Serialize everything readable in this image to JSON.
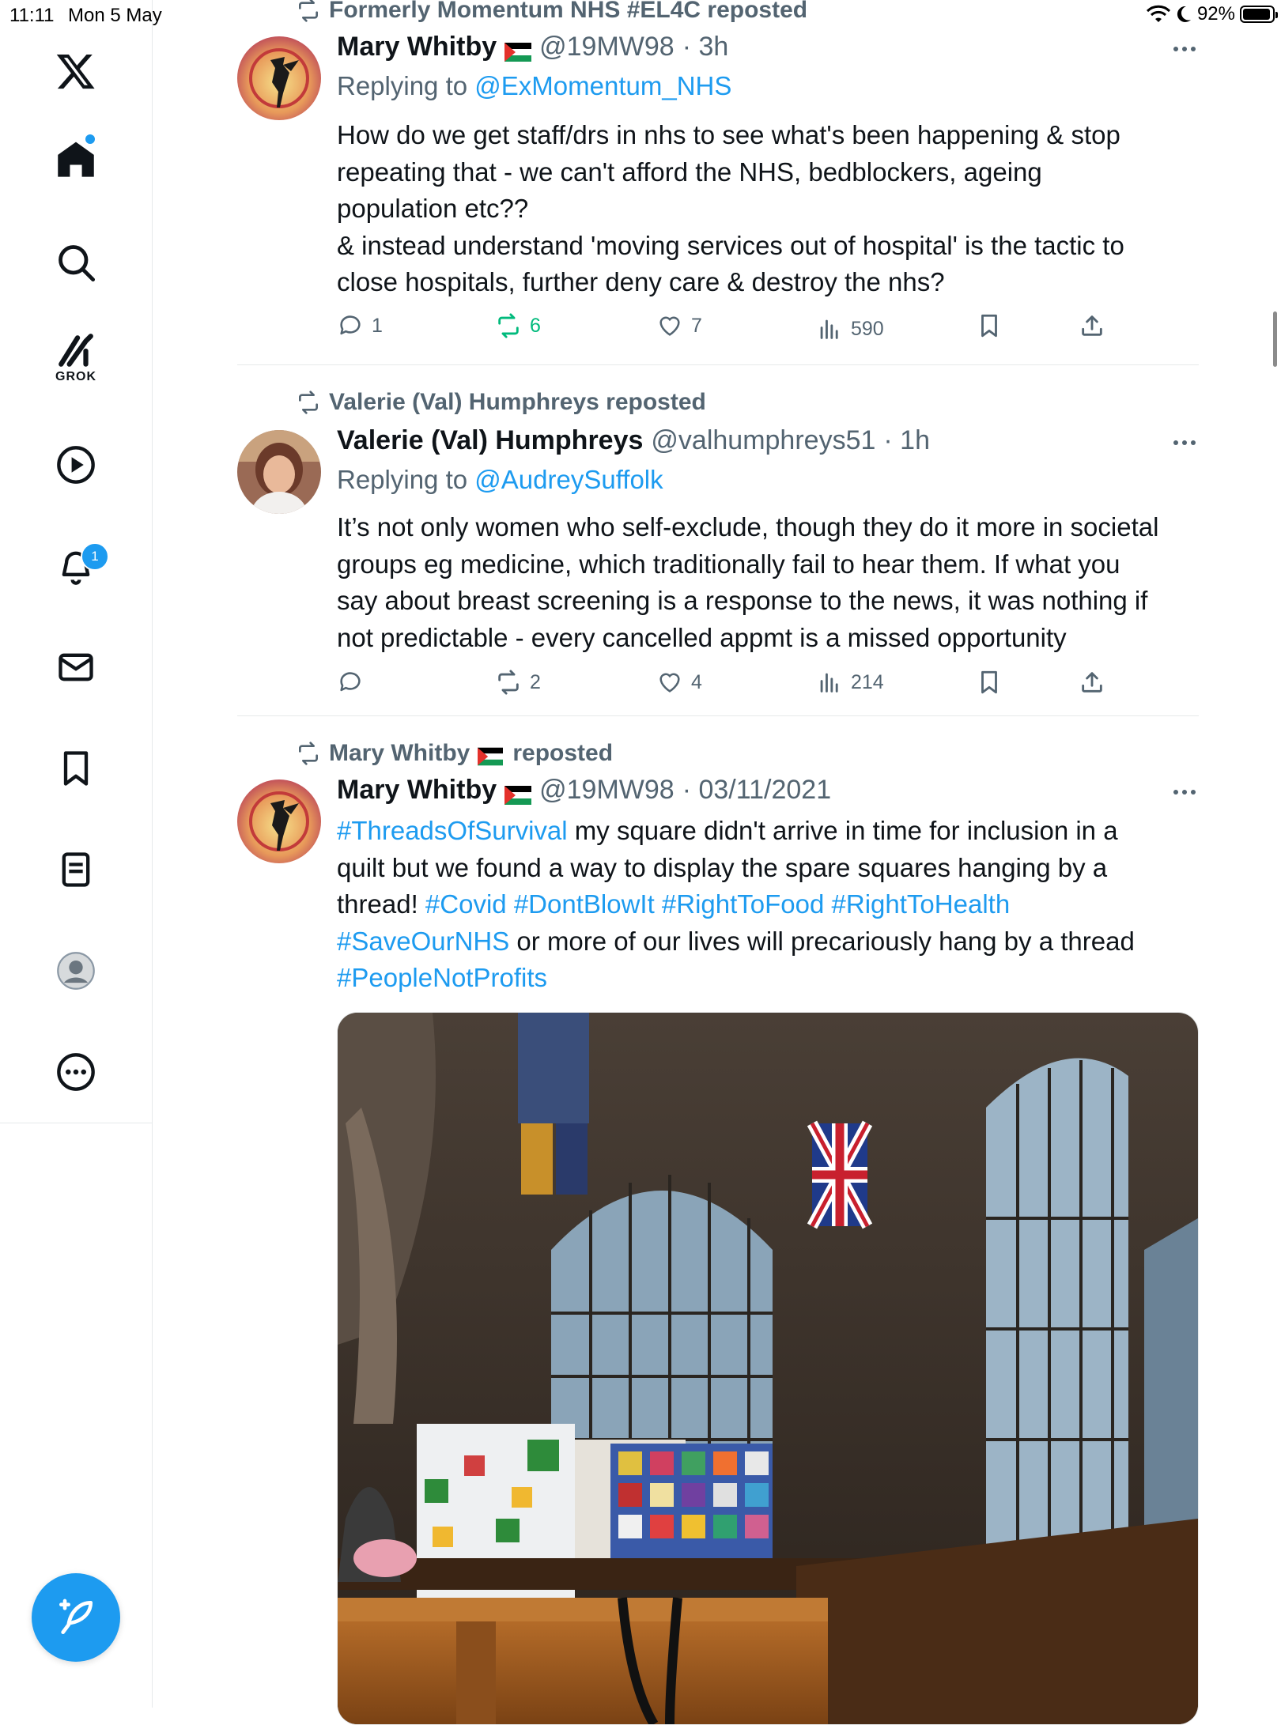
{
  "status_bar": {
    "time": "11:11",
    "date": "Mon 5 May",
    "battery": "92%"
  },
  "sidebar": {
    "grok_label": "GROK",
    "notifications_badge": "1",
    "items": [
      "x-logo",
      "home",
      "search",
      "grok",
      "videos",
      "notifications",
      "messages",
      "bookmarks",
      "lists",
      "profile",
      "more"
    ]
  },
  "tweets": [
    {
      "repost_by": "Formerly Momentum NHS #EL4C reposted",
      "name": "Mary Whitby",
      "handle": "@19MW98",
      "time": "· 3h",
      "replying_prefix": "Replying to",
      "replying_to": "@ExMomentum_NHS",
      "text_lines": [
        "How do we get staff/drs in nhs to see what's been happening & stop",
        "repeating that - we can't afford the NHS, bedblockers, ageing",
        "population etc??",
        "& instead understand 'moving services out of hospital' is the tactic to",
        "close hospitals, further deny care & destroy the nhs?"
      ],
      "replies": "1",
      "reposts": "6",
      "likes": "7",
      "views": "590"
    },
    {
      "repost_by": "Valerie (Val) Humphreys reposted",
      "name": "Valerie (Val) Humphreys",
      "handle": "@valhumphreys51",
      "time": "· 1h",
      "replying_prefix": "Replying to",
      "replying_to": "@AudreySuffolk",
      "text_lines": [
        "It’s not only women who self-exclude, though they do it more in societal",
        "groups eg medicine, which traditionally fail to hear them. If what you",
        "say about breast screening is a response to the news, it was nothing if",
        "not predictable - every cancelled appmt is a missed opportunity"
      ],
      "replies": "",
      "reposts": "2",
      "likes": "4",
      "views": "214"
    },
    {
      "repost_by": "Mary Whitby",
      "repost_suffix": "reposted",
      "name": "Mary Whitby",
      "handle": "@19MW98",
      "time": "· 03/11/2021",
      "line1_hashtag": "#ThreadsOfSurvival",
      "line1_rest": " my square didn't arrive in time for inclusion in a",
      "line2": "quilt but we found a way to display the spare squares hanging by a",
      "line3_text": "thread! ",
      "line3_hashtags": "#Covid #DontBlowIt #RightToFood #RightToHealth",
      "line4_hashtag": "#SaveOurNHS",
      "line4_rest": " or more of our lives will precariously hang by a thread",
      "line5_hashtag": "#PeopleNotProfits",
      "media_alt": "Church interior with quilts displayed over pews"
    }
  ],
  "colors": {
    "accent": "#1d9bf0",
    "repost_green": "#00ba7c",
    "muted": "#536471",
    "text": "#0f1419"
  }
}
